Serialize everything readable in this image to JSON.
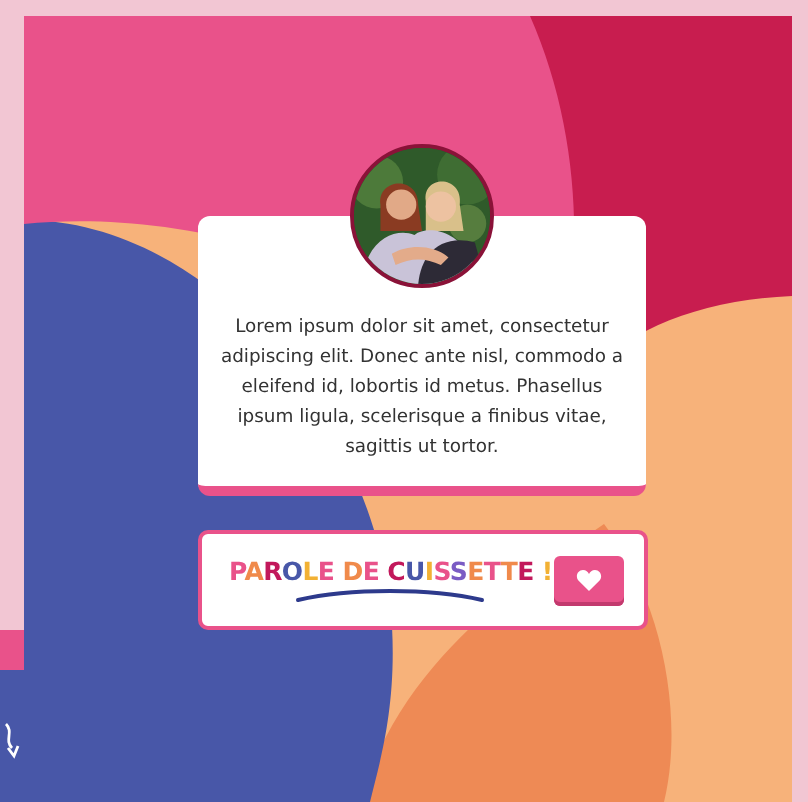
{
  "testimonial": {
    "text": "Lorem ipsum dolor sit amet, consectetur adipiscing elit. Donec ante nisl, commodo a eleifend id, lobortis id metus. Phasellus ipsum ligula, scelerisque a finibus vitae, sagittis ut tortor."
  },
  "brand_bar": {
    "logo": "PAROLE DE CUISSETTE !"
  }
}
